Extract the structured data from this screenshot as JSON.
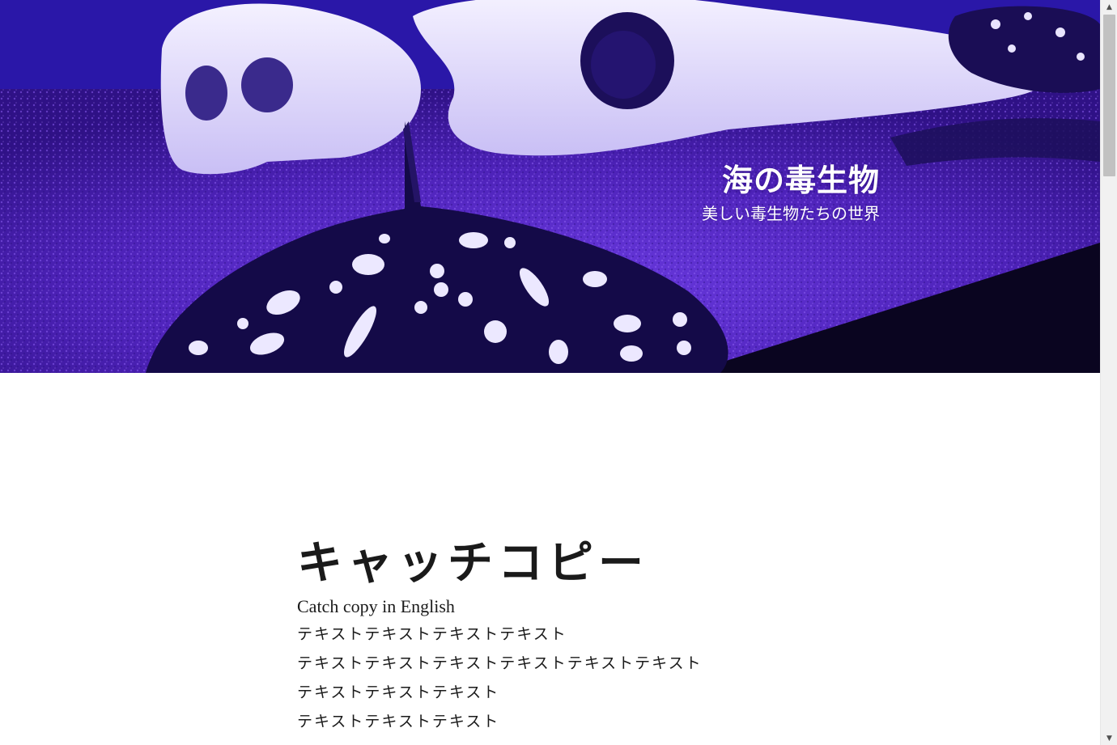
{
  "hero": {
    "title": "海の毒生物",
    "subtitle": "美しい毒生物たちの世界"
  },
  "main": {
    "catch_heading": "キャッチコピー",
    "catch_english": "Catch copy in English",
    "lines": [
      "テキストテキストテキストテキスト",
      "テキストテキストテキストテキストテキストテキスト",
      "テキストテキストテキスト",
      "テキストテキストテキスト"
    ]
  },
  "scrollbar": {
    "up_arrow": "▲",
    "down_arrow": "▼"
  }
}
